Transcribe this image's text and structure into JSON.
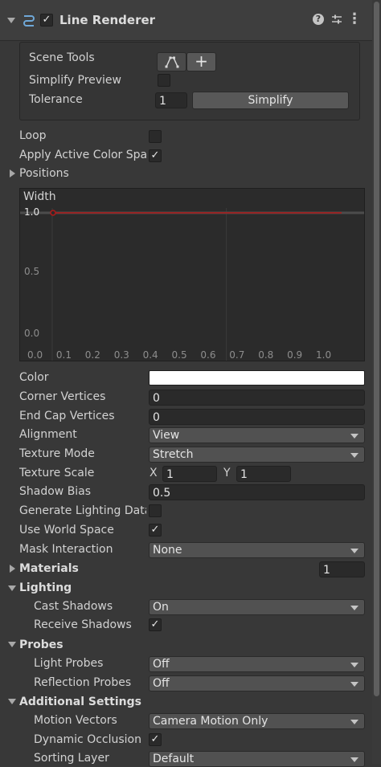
{
  "header": {
    "title": "Line Renderer",
    "enabled": true,
    "help_icon": "help-icon",
    "preset_icon": "sliders-icon",
    "menu_icon": "kebab-menu-icon"
  },
  "scene_tools": {
    "label": "Scene Tools",
    "simplify_preview_label": "Simplify Preview",
    "simplify_preview_checked": false,
    "tolerance_label": "Tolerance",
    "tolerance_value": "1",
    "simplify_button": "Simplify",
    "add_button": "+"
  },
  "props": {
    "loop": "Loop",
    "apply_active_color_space": "Apply Active Color Space",
    "positions": "Positions"
  },
  "width_curve": {
    "title": "Width",
    "y_labels": [
      "1.0",
      "0.5",
      "0.0"
    ],
    "x_labels": [
      "0.0",
      "0.1",
      "0.2",
      "0.3",
      "0.4",
      "0.5",
      "0.6",
      "0.7",
      "0.8",
      "0.9",
      "1.0"
    ],
    "value": 1.0,
    "curve_color": "#b01818"
  },
  "rows": {
    "color": {
      "label": "Color",
      "value_color": "#ffffff"
    },
    "corner_vertices": {
      "label": "Corner Vertices",
      "value": "0"
    },
    "end_cap_vertices": {
      "label": "End Cap Vertices",
      "value": "0"
    },
    "alignment": {
      "label": "Alignment",
      "value": "View"
    },
    "texture_mode": {
      "label": "Texture Mode",
      "value": "Stretch"
    },
    "texture_scale": {
      "label": "Texture Scale",
      "x_label": "X",
      "x_value": "1",
      "y_label": "Y",
      "y_value": "1"
    },
    "shadow_bias": {
      "label": "Shadow Bias",
      "value": "0.5"
    },
    "generate_lighting_data": {
      "label": "Generate Lighting Data",
      "checked": false
    },
    "use_world_space": {
      "label": "Use World Space",
      "checked": true
    },
    "mask_interaction": {
      "label": "Mask Interaction",
      "value": "None"
    }
  },
  "materials": {
    "label": "Materials",
    "count": "1"
  },
  "lighting": {
    "label": "Lighting",
    "cast_shadows_label": "Cast Shadows",
    "cast_shadows_value": "On",
    "receive_shadows_label": "Receive Shadows",
    "receive_shadows_checked": true
  },
  "probes": {
    "label": "Probes",
    "light_probes_label": "Light Probes",
    "light_probes_value": "Off",
    "reflection_probes_label": "Reflection Probes",
    "reflection_probes_value": "Off"
  },
  "additional": {
    "label": "Additional Settings",
    "motion_vectors_label": "Motion Vectors",
    "motion_vectors_value": "Camera Motion Only",
    "dynamic_occlusion_label": "Dynamic Occlusion",
    "dynamic_occlusion_checked": true,
    "sorting_layer_label": "Sorting Layer",
    "sorting_layer_value": "Default"
  },
  "glyphs": {
    "check": "✓",
    "help": "?",
    "kebab": "⋮"
  }
}
